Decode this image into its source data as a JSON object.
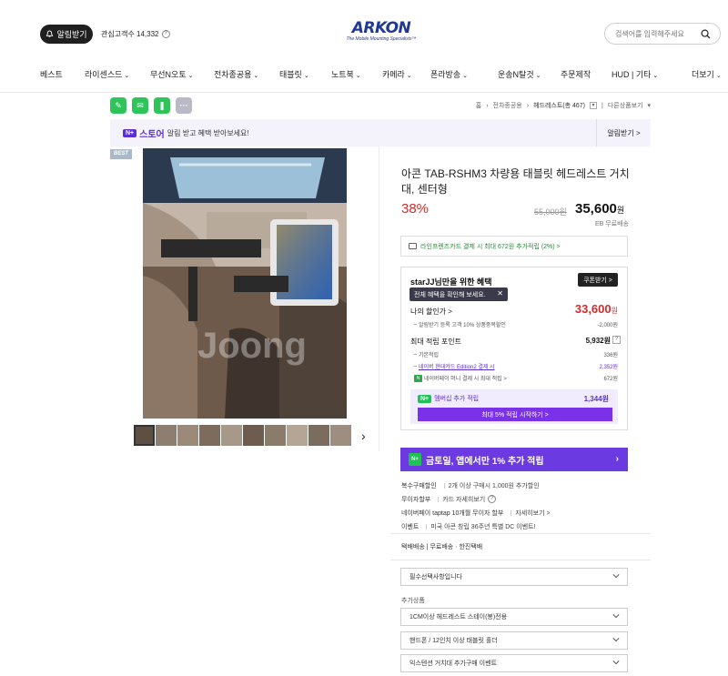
{
  "header": {
    "notify_label": "알림받기",
    "favorites_label": "관심고객수 14,332",
    "logo_main": "ARKON",
    "logo_sub": "The Mobile Mounting Specialists™",
    "search_placeholder": "검색어를 입력해주세요"
  },
  "nav": [
    {
      "label": "베스트",
      "chev": false
    },
    {
      "label": "라이센스드",
      "chev": true
    },
    {
      "label": "무선N오토",
      "chev": true
    },
    {
      "label": "전차종공용",
      "chev": true
    },
    {
      "label": "태블릿",
      "chev": true
    },
    {
      "label": "노트북",
      "chev": true
    },
    {
      "label": "카메라",
      "chev": true
    },
    {
      "label": "폰라방송",
      "chev": true
    },
    {
      "label": "운송N탈것",
      "chev": true
    },
    {
      "label": "주문제작",
      "chev": false
    },
    {
      "label": "HUD | 기타",
      "chev": true
    },
    {
      "label": "더보기",
      "chev": true
    }
  ],
  "breadcrumb": {
    "home": "홈",
    "cat": "전차종공용",
    "current": "헤드레스트(총 467)",
    "other": "다른상품보기"
  },
  "store_banner": {
    "badge": "N+",
    "title": "스토어",
    "text": "알림 받고 혜택 받아보세요!",
    "right": "알림받기 >"
  },
  "product": {
    "best_tag": "BEST",
    "title": "아콘 TAB-RSHM3 차량용 태블릿 헤드레스트 거치대, 센터형",
    "discount": "38%",
    "old_price": "55,000원",
    "new_price": "35,600",
    "won": "원",
    "shipping": "EB 무료배송"
  },
  "card_row": "라인프렌즈카드 결제 시 최대 672원 추가적립 (2%) >",
  "benefit": {
    "head": "starJJ님만을 위한 혜택",
    "coupon_btn": "쿠폰받기 >",
    "tooltip": "전체 혜택을 확인해 보세요.",
    "tooltip_close": "✕",
    "my_disc_label": "나의 할인가 >",
    "my_disc_val": "33,600",
    "my_disc_won": "원",
    "sub1_label": "알림받기 등록 고객 10% 상품중복할인",
    "sub1_val": "-2,000원",
    "points_label": "최대 적립 포인트",
    "points_val": "5,932원",
    "p1_label": "기본적립",
    "p1_val": "336원",
    "p2_label": "네이버 현대카드 Edition2 결제 시",
    "p2_val": "2,352원",
    "p3_label": "네이버페이 머니 결제 시 최대 적립 >",
    "p3_val": "672원",
    "member_label": "멤버십 추가 적립",
    "member_val": "1,344원",
    "member_btn": "최대 5% 적립 시작하기 >"
  },
  "promo": {
    "text": "금토일, 앱에서만 1% 추가 적립",
    "icon": "N+"
  },
  "info_rows": [
    {
      "k": "복수구매할인",
      "v": "2개 이상 구매시 1,000원 추가할인",
      "extra": ""
    },
    {
      "k": "무이자할부",
      "v": "카드 자세히보기",
      "extra": "?"
    },
    {
      "k": "네이버페이 taptap 10개월 무이자 할부",
      "v": "자세히보기 >",
      "extra": ""
    },
    {
      "k": "이벤트",
      "v": "미국 아콘 창립 36주년 특별 DC 이벤트!",
      "extra": ""
    }
  ],
  "delivery": "택배배송 | 무료배송 · 한진택배",
  "options": {
    "required": "필수선택사항입니다",
    "add_label": "추가상품",
    "add1": "1CM이상 헤드레스트 스테이(봉)전용",
    "add2": "핸드폰 / 12인치 이상 태블릿 홀더",
    "add3": "익스텐션 거치대 추가구매 이벤트"
  }
}
